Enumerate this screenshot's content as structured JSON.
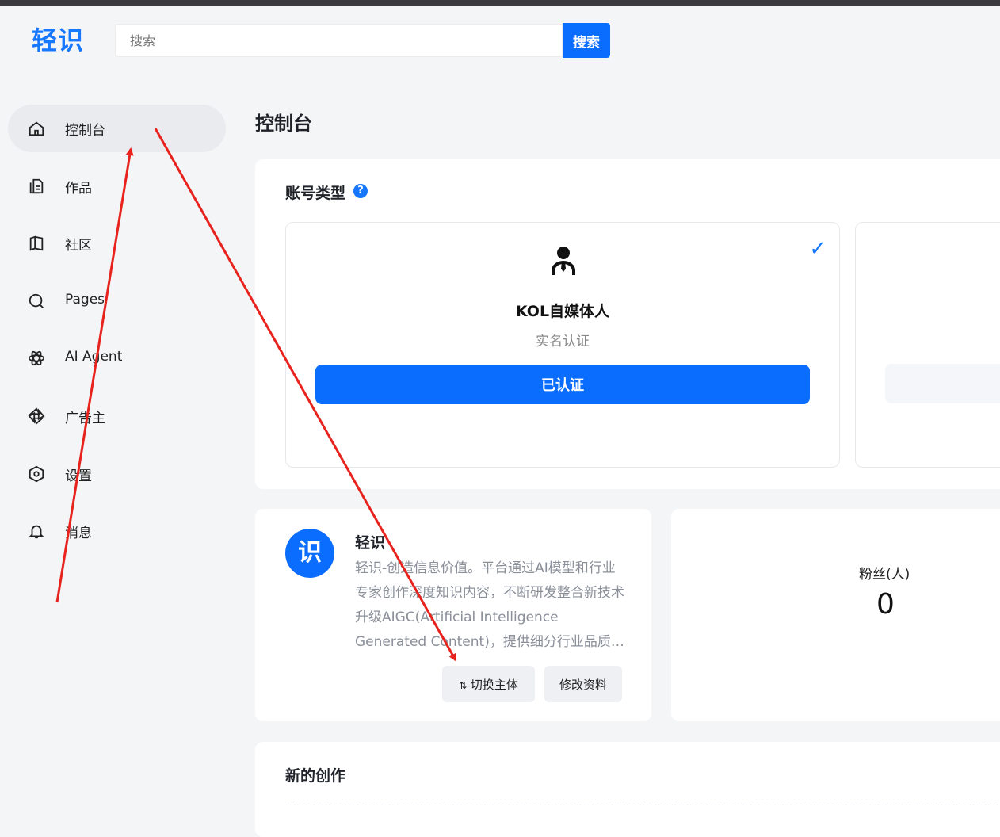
{
  "header": {
    "logo": "轻识",
    "search": {
      "placeholder": "搜索",
      "button_label": "搜索"
    }
  },
  "sidebar": {
    "items": [
      {
        "label": "控制台",
        "icon": "home-icon",
        "active": true
      },
      {
        "label": "作品",
        "icon": "document-icon"
      },
      {
        "label": "社区",
        "icon": "book-icon"
      },
      {
        "label": "Pages",
        "icon": "search-circle-icon"
      },
      {
        "label": "AI Agent",
        "icon": "atom-icon"
      },
      {
        "label": "广告主",
        "icon": "aperture-icon"
      },
      {
        "label": "设置",
        "icon": "hexagon-settings-icon"
      },
      {
        "label": "消息",
        "icon": "bell-icon"
      }
    ]
  },
  "page": {
    "title": "控制台"
  },
  "account_type": {
    "title": "账号类型",
    "help": "?",
    "kol": {
      "name": "KOL自媒体人",
      "subtitle": "实名认证",
      "button_label": "已认证",
      "check": "✓"
    }
  },
  "profile": {
    "avatar_text": "识",
    "name": "轻识",
    "description": "轻识-创造信息价值。平台通过AI模型和行业专家创作深度知识内容，不断研发整合新技术升级AIGC(Artificial Intelligence Generated Content)，提供细分行业品质…",
    "switch_label": "切换主体",
    "edit_label": "修改资料"
  },
  "fans": {
    "label": "粉丝(人)",
    "value": "0"
  },
  "new_creations": {
    "title": "新的创作"
  },
  "colors": {
    "accent": "#0b6dfd",
    "annotation": "#e8231e"
  }
}
